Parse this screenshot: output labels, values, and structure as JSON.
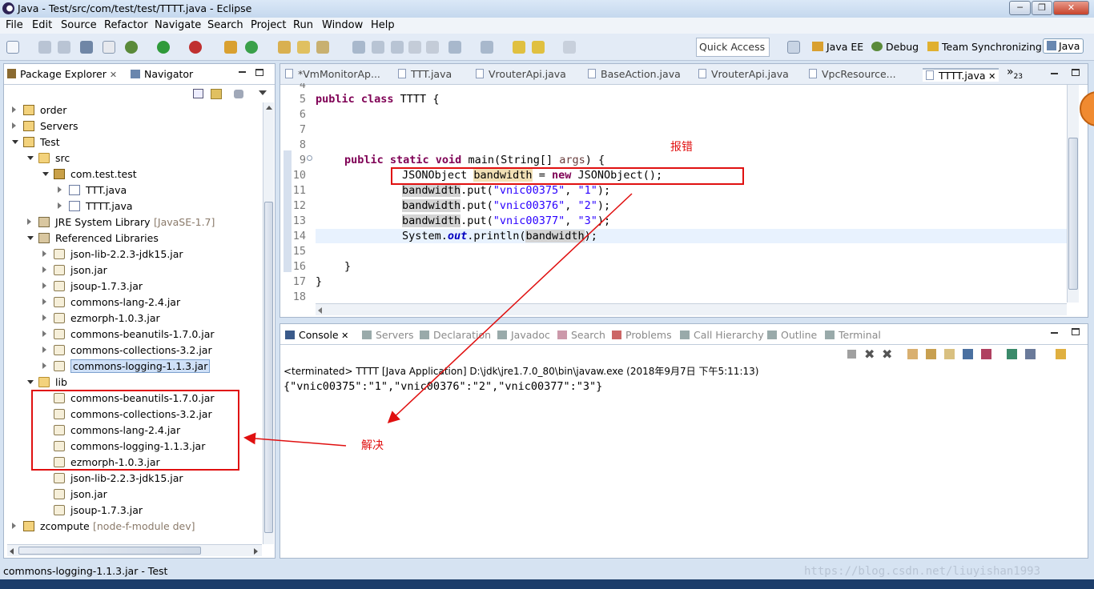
{
  "window": {
    "title": "Java - Test/src/com/test/test/TTTT.java - Eclipse",
    "min": "─",
    "max": "❐",
    "close": "✕"
  },
  "menu": [
    "File",
    "Edit",
    "Source",
    "Refactor",
    "Navigate",
    "Search",
    "Project",
    "Run",
    "Window",
    "Help"
  ],
  "toolbar": {
    "quick_access_placeholder": "Quick Access"
  },
  "perspectives": [
    "Java EE",
    "Debug",
    "Team Synchronizing",
    "Java"
  ],
  "left_panel": {
    "tabs": [
      "Package Explorer",
      "Navigator"
    ],
    "tree": [
      {
        "label": "order",
        "indent": 0,
        "icon": "project-folder-icon",
        "tw": "c"
      },
      {
        "label": "Servers",
        "indent": 0,
        "icon": "project-folder-icon",
        "tw": "c"
      },
      {
        "label": "Test",
        "indent": 0,
        "icon": "project-folder-icon",
        "tw": "o"
      },
      {
        "label": "src",
        "indent": 1,
        "icon": "source-folder-icon",
        "tw": "o"
      },
      {
        "label": "com.test.test",
        "indent": 2,
        "icon": "package-icon",
        "tw": "o"
      },
      {
        "label": "TTT.java",
        "indent": 3,
        "icon": "java-file-icon",
        "tw": "c"
      },
      {
        "label": "TTTT.java",
        "indent": 3,
        "icon": "java-file-icon",
        "tw": "c"
      },
      {
        "label": "JRE System Library",
        "suffix": "[JavaSE-1.7]",
        "indent": 1,
        "icon": "library-icon",
        "tw": "c"
      },
      {
        "label": "Referenced Libraries",
        "indent": 1,
        "icon": "library-icon",
        "tw": "o"
      },
      {
        "label": "json-lib-2.2.3-jdk15.jar",
        "indent": 2,
        "icon": "jar-icon",
        "tw": "c"
      },
      {
        "label": "json.jar",
        "indent": 2,
        "icon": "jar-icon",
        "tw": "c"
      },
      {
        "label": "jsoup-1.7.3.jar",
        "indent": 2,
        "icon": "jar-icon",
        "tw": "c"
      },
      {
        "label": "commons-lang-2.4.jar",
        "indent": 2,
        "icon": "jar-icon",
        "tw": "c"
      },
      {
        "label": "ezmorph-1.0.3.jar",
        "indent": 2,
        "icon": "jar-icon",
        "tw": "c"
      },
      {
        "label": "commons-beanutils-1.7.0.jar",
        "indent": 2,
        "icon": "jar-icon",
        "tw": "c"
      },
      {
        "label": "commons-collections-3.2.jar",
        "indent": 2,
        "icon": "jar-icon",
        "tw": "c"
      },
      {
        "label": "commons-logging-1.1.3.jar",
        "indent": 2,
        "icon": "jar-icon",
        "tw": "c",
        "selected": true
      },
      {
        "label": "lib",
        "indent": 1,
        "icon": "folder-icon",
        "tw": "o"
      },
      {
        "label": "commons-beanutils-1.7.0.jar",
        "indent": 2,
        "icon": "jar-file-icon",
        "tw": ""
      },
      {
        "label": "commons-collections-3.2.jar",
        "indent": 2,
        "icon": "jar-file-icon",
        "tw": ""
      },
      {
        "label": "commons-lang-2.4.jar",
        "indent": 2,
        "icon": "jar-file-icon",
        "tw": ""
      },
      {
        "label": "commons-logging-1.1.3.jar",
        "indent": 2,
        "icon": "jar-file-icon",
        "tw": ""
      },
      {
        "label": "ezmorph-1.0.3.jar",
        "indent": 2,
        "icon": "jar-file-icon",
        "tw": ""
      },
      {
        "label": "json-lib-2.2.3-jdk15.jar",
        "indent": 2,
        "icon": "jar-file-icon",
        "tw": ""
      },
      {
        "label": "json.jar",
        "indent": 2,
        "icon": "jar-file-icon",
        "tw": ""
      },
      {
        "label": "jsoup-1.7.3.jar",
        "indent": 2,
        "icon": "jar-file-icon",
        "tw": ""
      },
      {
        "label": "zcompute",
        "suffix": "[node-f-module dev]",
        "indent": 0,
        "icon": "project-folder-icon",
        "tw": "c"
      }
    ]
  },
  "editor": {
    "tabs": [
      "*VmMonitorAp...",
      "TTT.java",
      "VrouterApi.java",
      "BaseAction.java",
      "VrouterApi.java",
      "VpcResource...",
      "TTTT.java"
    ],
    "overflow": "»",
    "overflow_count": "23",
    "line_numbers": [
      "4",
      "5",
      "6",
      "7",
      "8",
      "9",
      "10",
      "11",
      "12",
      "13",
      "14",
      "15",
      "16",
      "17",
      "18"
    ],
    "code": {
      "l5_kw": "public class",
      "l5_rest": " TTTT {",
      "l9_kw": "public static void",
      "l9_a": " main(String[] ",
      "l9_args": "args",
      "l9_b": ") {",
      "l10_a": "JSONObject ",
      "l10_var": "bandwidth",
      "l10_b": " = ",
      "l10_new": "new",
      "l10_c": " JSONObject();",
      "l11_var": "bandwidth",
      "l11_a": ".put(",
      "l11_s1": "\"vnic00375\"",
      "l11_b": ", ",
      "l11_s2": "\"1\"",
      "l11_c": ");",
      "l12_var": "bandwidth",
      "l12_a": ".put(",
      "l12_s1": "\"vnic00376\"",
      "l12_b": ", ",
      "l12_s2": "\"2\"",
      "l12_c": ");",
      "l13_var": "bandwidth",
      "l13_a": ".put(",
      "l13_s1": "\"vnic00377\"",
      "l13_b": ", ",
      "l13_s2": "\"3\"",
      "l13_c": ");",
      "l14_a": "System.",
      "l14_out": "out",
      "l14_b": ".println(",
      "l14_var": "bandwidth",
      "l14_c": ");",
      "l16": "}",
      "l17": "}"
    },
    "annotation_error": "报错"
  },
  "console": {
    "tabs": [
      "Console",
      "Servers",
      "Declaration",
      "Javadoc",
      "Search",
      "Problems",
      "Call Hierarchy",
      "Outline",
      "Terminal"
    ],
    "header": "<terminated> TTTT [Java Application] D:\\jdk\\jre1.7.0_80\\bin\\javaw.exe (2018年9月7日 下午5:11:13)",
    "output": "{\"vnic00375\":\"1\",\"vnic00376\":\"2\",\"vnic00377\":\"3\"}"
  },
  "annotation_fix": "解决",
  "status_bar": {
    "text": "commons-logging-1.1.3.jar - Test",
    "watermark": "https://blog.csdn.net/liuyishan1993"
  },
  "colors": {
    "annotation_red": "#e01010",
    "keyword": "#7f0055",
    "string": "#2a00ff"
  }
}
